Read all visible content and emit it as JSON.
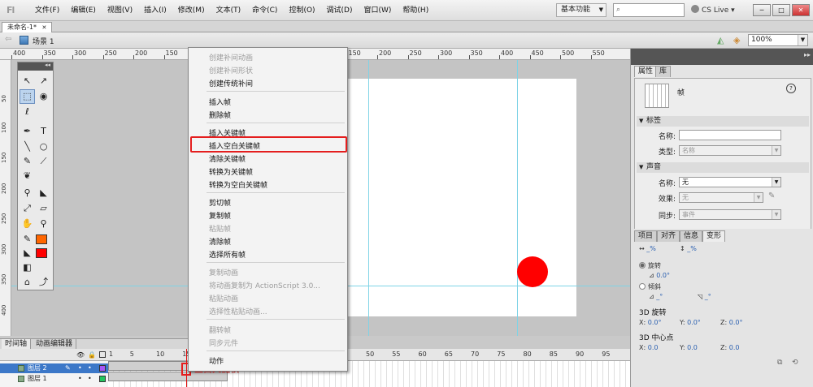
{
  "app": {
    "logo": "Fl"
  },
  "menubar": {
    "items": [
      "文件(F)",
      "编辑(E)",
      "视图(V)",
      "插入(I)",
      "修改(M)",
      "文本(T)",
      "命令(C)",
      "控制(O)",
      "调试(D)",
      "窗口(W)",
      "帮助(H)"
    ],
    "workspace": "基本功能",
    "search_placeholder": "",
    "cs_live": "CS Live",
    "win_min": "─",
    "win_max": "□",
    "win_close": "✕"
  },
  "document": {
    "tab": "未命名-1*",
    "tab_close": "✕"
  },
  "scenebar": {
    "back": "⇦",
    "scene": "场景 1",
    "zoom": "100%"
  },
  "ruler": {
    "h_labels": [
      "400",
      "350",
      "300",
      "250",
      "200",
      "150",
      "100",
      "50",
      "0",
      "50",
      "100",
      "150",
      "200",
      "250",
      "300",
      "350",
      "400",
      "450",
      "500",
      "550"
    ],
    "v_labels": [
      "50",
      "100",
      "150",
      "200",
      "250",
      "300",
      "350",
      "400"
    ]
  },
  "tools": [
    "selection-tool",
    "subselection-tool",
    "free-transform-tool",
    "3d-rotation-tool",
    "lasso-tool",
    "pen-tool",
    "text-tool",
    "line-tool",
    "oval-tool",
    "pencil-tool",
    "brush-tool",
    "deco-tool",
    "bone-tool",
    "paint-bucket-tool",
    "eyedropper-tool",
    "eraser-tool",
    "hand-tool",
    "zoom-tool"
  ],
  "tool_glyphs": {
    "text": "T"
  },
  "colors": {
    "stroke": "#ff6600",
    "fill": "#ff0000",
    "ball": "#ff0000",
    "highlight": "#e41e1e"
  },
  "context_menu": {
    "items": [
      {
        "label": "创建补间动画",
        "enabled": false
      },
      {
        "label": "创建补间形状",
        "enabled": false
      },
      {
        "label": "创建传统补间",
        "enabled": true
      },
      {
        "label": "插入帧",
        "enabled": true
      },
      {
        "label": "删除帧",
        "enabled": true
      },
      {
        "label": "插入关键帧",
        "enabled": true
      },
      {
        "label": "插入空白关键帧",
        "enabled": true
      },
      {
        "label": "清除关键帧",
        "enabled": true
      },
      {
        "label": "转换为关键帧",
        "enabled": true
      },
      {
        "label": "转换为空白关键帧",
        "enabled": true
      },
      {
        "label": "剪切帧",
        "enabled": true
      },
      {
        "label": "复制帧",
        "enabled": true
      },
      {
        "label": "粘贴帧",
        "enabled": false
      },
      {
        "label": "清除帧",
        "enabled": true
      },
      {
        "label": "选择所有帧",
        "enabled": true
      },
      {
        "label": "复制动画",
        "enabled": false
      },
      {
        "label": "将动画复制为 ActionScript 3.0...",
        "enabled": false
      },
      {
        "label": "粘贴动画",
        "enabled": false
      },
      {
        "label": "选择性粘贴动画...",
        "enabled": false
      },
      {
        "label": "翻转帧",
        "enabled": false
      },
      {
        "label": "同步元件",
        "enabled": false
      },
      {
        "label": "动作",
        "enabled": true
      }
    ]
  },
  "timeline": {
    "tabs": [
      "时间轴",
      "动画编辑器"
    ],
    "frame_numbers": [
      "1",
      "5",
      "10",
      "15",
      "20",
      "25",
      "30",
      "35",
      "40",
      "45",
      "50",
      "55",
      "60",
      "65",
      "70",
      "75",
      "80",
      "85",
      "90",
      "95",
      "100",
      "105",
      "110"
    ],
    "layers": [
      {
        "name": "图层 2",
        "selected": true,
        "color": "#a855f7"
      },
      {
        "name": "图层 1",
        "selected": false,
        "color": "#22c55e"
      }
    ],
    "annotation": "空白关键帧"
  },
  "properties": {
    "tabs": [
      "属性",
      "库"
    ],
    "title": "帧",
    "help": "?",
    "label_section": "标签",
    "name_label": "名称:",
    "name_value": "",
    "type_label": "类型:",
    "type_value": "名称",
    "sound_section": "声音",
    "sound_name_label": "名称:",
    "sound_name_value": "无",
    "effect_label": "效果:",
    "effect_value": "无",
    "sync_label": "同步:",
    "sync_value": "事件"
  },
  "transform": {
    "tabs": [
      "项目",
      "对齐",
      "信息",
      "变形"
    ],
    "w_pct": "_%",
    "h_pct": "_%",
    "rotate_label": "旋转",
    "rotate_value": "0.0°",
    "skew_label": "倾斜",
    "skew_h": "_°",
    "skew_v": "_°",
    "rot3d_label": "3D 旋转",
    "x_label": "X:",
    "y_label": "Y:",
    "z_label": "Z:",
    "rot3d_x": "0.0°",
    "rot3d_y": "0.0°",
    "rot3d_z": "0.0°",
    "center3d_label": "3D 中心点",
    "center_x": "0.0",
    "center_y": "0.0",
    "center_z": "0.0"
  }
}
